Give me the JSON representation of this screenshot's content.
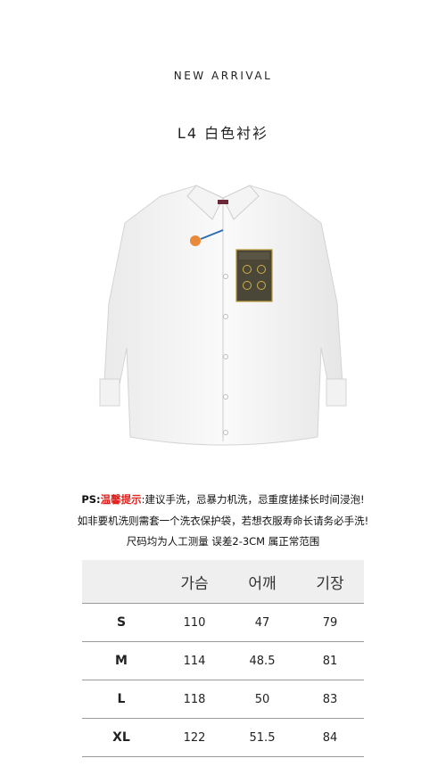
{
  "header": {
    "title": "NEW ARRIVAL"
  },
  "product": {
    "name": "L4 白色衬衫"
  },
  "notice": {
    "line1_prefix": "PS:",
    "line1_highlight": "温馨提示",
    "line1_rest": ":建议手洗，忌暴力机洗，忌重度搓揉长时间浸泡!",
    "line2": "如非要机洗则需套一个洗衣保护袋，若想衣服寿命长请务必手洗!",
    "line3": "尺码均为人工测量 误差2-3CM 属正常范围"
  },
  "size_table": {
    "headers": [
      "",
      "가슴",
      "어깨",
      "기장"
    ],
    "rows": [
      {
        "size": "S",
        "chest": "110",
        "shoulder": "47",
        "length": "79"
      },
      {
        "size": "M",
        "chest": "114",
        "shoulder": "48.5",
        "length": "81"
      },
      {
        "size": "L",
        "chest": "118",
        "shoulder": "50",
        "length": "83"
      },
      {
        "size": "XL",
        "chest": "122",
        "shoulder": "51.5",
        "length": "84"
      }
    ]
  }
}
